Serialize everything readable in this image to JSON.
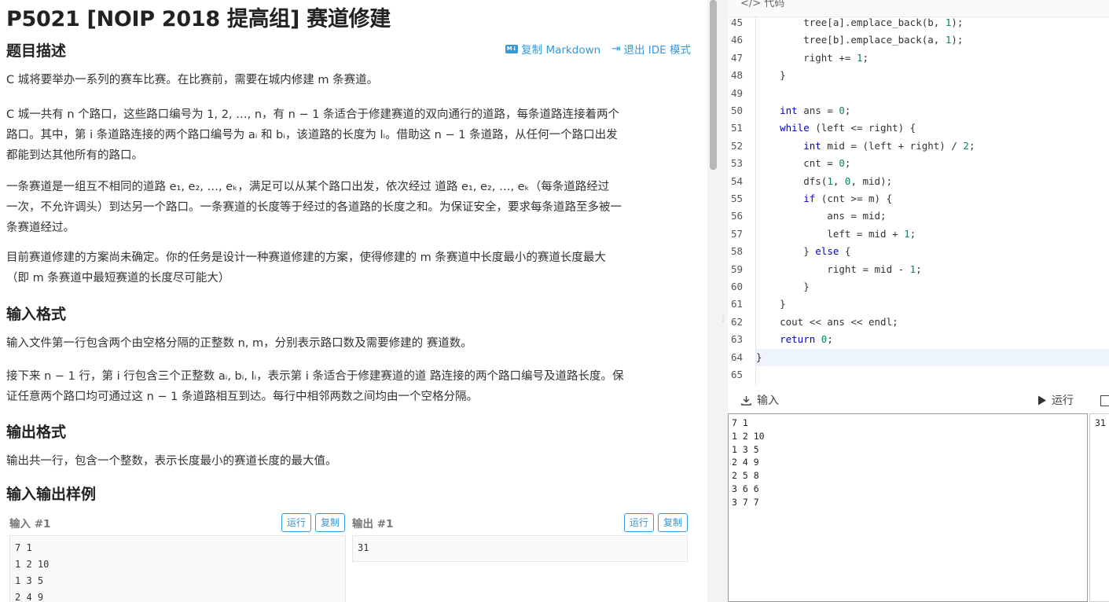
{
  "problem": {
    "title": "P5021 [NOIP 2018 提高组] 赛道修建",
    "actions": {
      "copy_markdown": "复制 Markdown",
      "exit_ide": "退出 IDE 模式"
    },
    "desc_heading": "题目描述",
    "p1": "C 城将要举办一系列的赛车比赛。在比赛前，需要在城内修建 m 条赛道。",
    "p2a": "C 城一共有 n 个路口，这些路口编号为 1, 2, …, n，有 n − 1 条适合于修建赛道的双向通行的道路，每条道路连接着两个",
    "p2b": "路口。其中，第 i 条道路连接的两个路口编号为 aᵢ 和 bᵢ，该道路的长度为 lᵢ。借助这 n − 1 条道路，从任何一个路口出发",
    "p2c": "都能到达其他所有的路口。",
    "p3a": "一条赛道是一组互不相同的道路 e₁, e₂, …, eₖ，满足可以从某个路口出发，依次经过 道路 e₁, e₂, …, eₖ（每条道路经过",
    "p3b": "一次，不允许调头）到达另一个路口。一条赛道的长度等于经过的各道路的长度之和。为保证安全，要求每条道路至多被一",
    "p3c": "条赛道经过。",
    "p4a": "目前赛道修建的方案尚未确定。你的任务是设计一种赛道修建的方案，使得修建的 m 条赛道中长度最小的赛道长度最大",
    "p4b": "（即 m 条赛道中最短赛道的长度尽可能大）",
    "input_heading": "输入格式",
    "p5": "输入文件第一行包含两个由空格分隔的正整数 n, m，分别表示路口数及需要修建的 赛道数。",
    "p6a": "接下来 n − 1 行，第 i 行包含三个正整数 aᵢ, bᵢ, lᵢ，表示第 i 条适合于修建赛道的道 路连接的两个路口编号及道路长度。保",
    "p6b": "证任意两个路口均可通过这 n − 1 条道路相互到达。每行中相邻两数之间均由一个空格分隔。",
    "output_heading": "输出格式",
    "p7": "输出共一行，包含一个整数，表示长度最小的赛道长度的最大值。",
    "sample_heading": "输入输出样例",
    "sample_in_label": "输入 #1",
    "sample_out_label": "输出 #1",
    "run": "运行",
    "copy": "复制",
    "sample_in": "7 1\n1 2 10\n1 3 5\n2 4 9",
    "sample_out": "31"
  },
  "ide": {
    "header": "代码",
    "lines": [
      {
        "n": "45",
        "t": "        tree[a].emplace_back(b, 1);"
      },
      {
        "n": "46",
        "t": "        tree[b].emplace_back(a, 1);"
      },
      {
        "n": "47",
        "t": "        right += 1;"
      },
      {
        "n": "48",
        "t": "    }"
      },
      {
        "n": "49",
        "t": ""
      },
      {
        "n": "50",
        "t": "    int ans = 0;"
      },
      {
        "n": "51",
        "t": "    while (left <= right) {"
      },
      {
        "n": "52",
        "t": "        int mid = (left + right) / 2;"
      },
      {
        "n": "53",
        "t": "        cnt = 0;"
      },
      {
        "n": "54",
        "t": "        dfs(1, 0, mid);"
      },
      {
        "n": "55",
        "t": "        if (cnt >= m) {"
      },
      {
        "n": "56",
        "t": "            ans = mid;"
      },
      {
        "n": "57",
        "t": "            left = mid + 1;"
      },
      {
        "n": "58",
        "t": "        } else {"
      },
      {
        "n": "59",
        "t": "            right = mid - 1;"
      },
      {
        "n": "60",
        "t": "        }"
      },
      {
        "n": "61",
        "t": "    }"
      },
      {
        "n": "62",
        "t": "    cout << ans << endl;"
      },
      {
        "n": "63",
        "t": "    return 0;"
      },
      {
        "n": "64",
        "t": "}"
      },
      {
        "n": "65",
        "t": ""
      }
    ],
    "active_line": "64",
    "input_label": "输入",
    "run_label": "运行",
    "input_value": "7 1\n1 2 10\n1 3 5\n2 4 9\n2 5 8\n3 6 6\n3 7 7",
    "output_value": "31"
  }
}
